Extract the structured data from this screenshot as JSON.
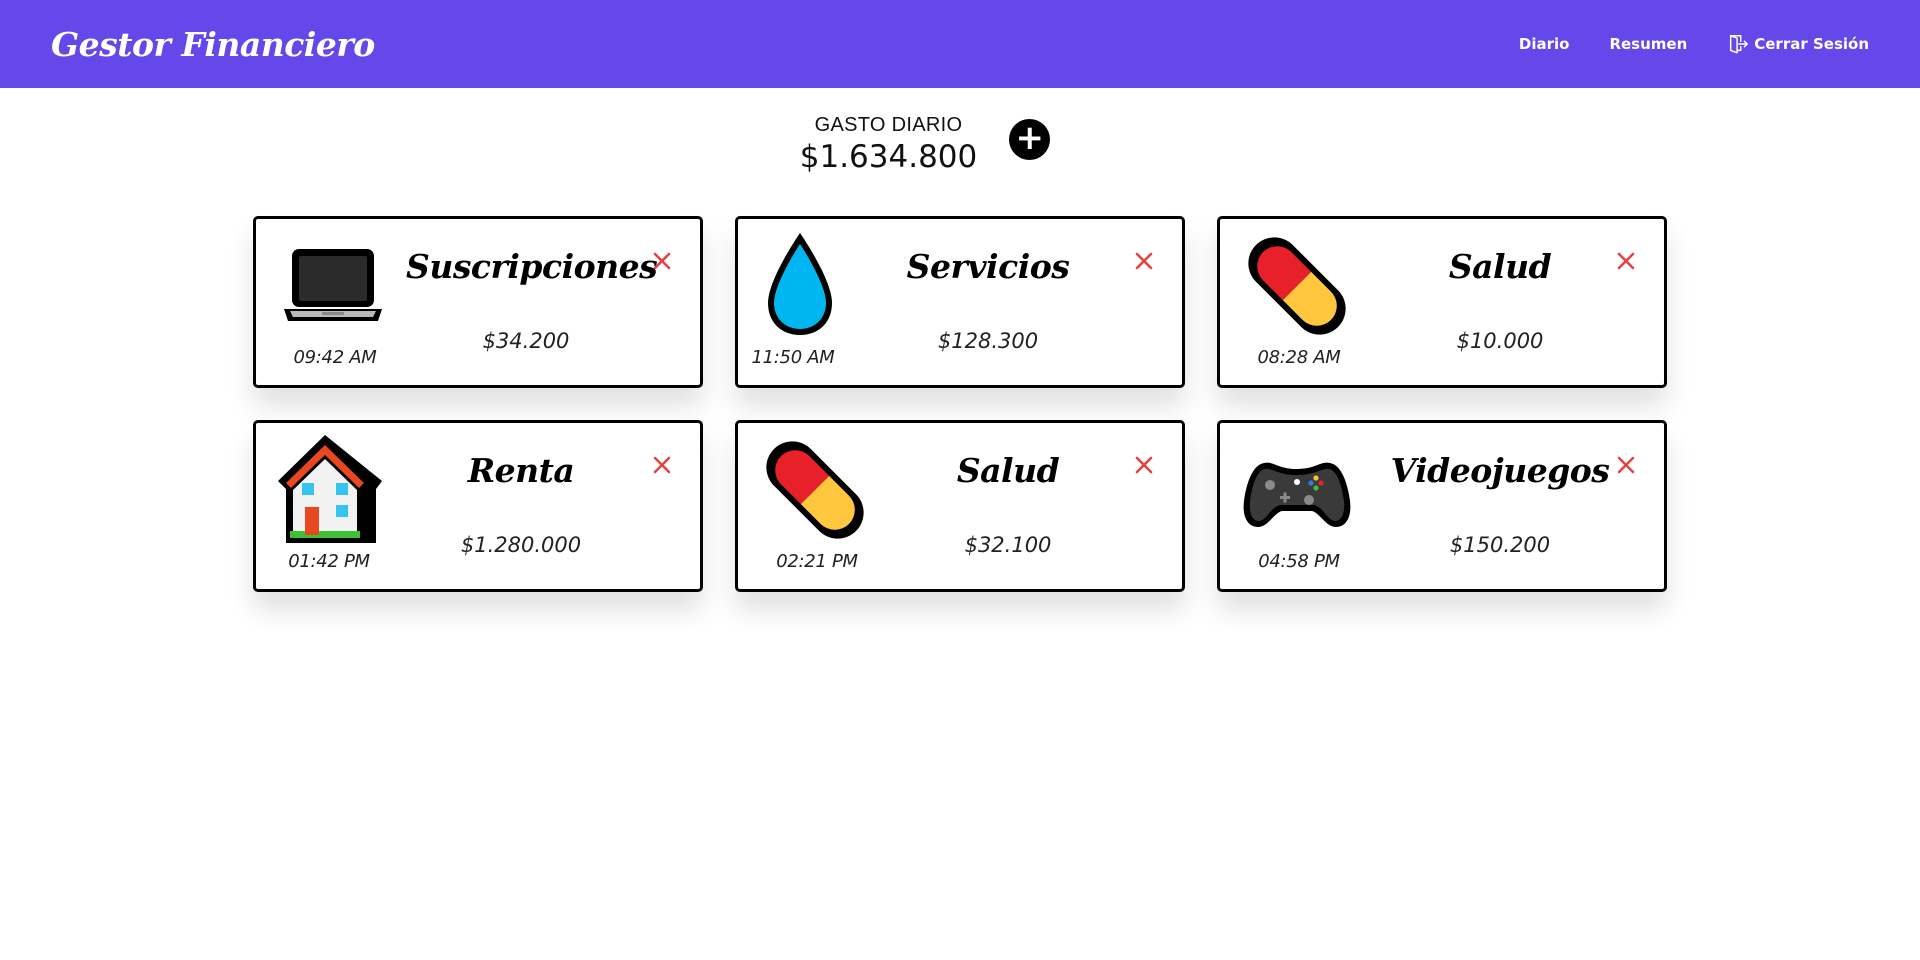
{
  "app": {
    "brand": "Gestor Financiero"
  },
  "nav": {
    "diario": "Diario",
    "resumen": "Resumen",
    "logout": "Cerrar Sesión"
  },
  "summary": {
    "label": "GASTO DIARIO",
    "total": "$1.634.800",
    "add_icon": "plus-circle-icon"
  },
  "colors": {
    "header": "#6448ea",
    "delete": "#e04545",
    "pill_red": "#e8202a",
    "pill_yellow": "#ffc73d",
    "water": "#00b6f0"
  },
  "expenses": [
    {
      "category": "Suscripciones",
      "amount": "$34.200",
      "time": "09:42 AM",
      "icon": "laptop-icon"
    },
    {
      "category": "Servicios",
      "amount": "$128.300",
      "time": "11:50 AM",
      "icon": "water-drop-icon"
    },
    {
      "category": "Salud",
      "amount": "$10.000",
      "time": "08:28 AM",
      "icon": "pill-icon"
    },
    {
      "category": "Renta",
      "amount": "$1.280.000",
      "time": "01:42 PM",
      "icon": "house-icon"
    },
    {
      "category": "Salud",
      "amount": "$32.100",
      "time": "02:21 PM",
      "icon": "pill-icon"
    },
    {
      "category": "Videojuegos",
      "amount": "$150.200",
      "time": "04:58 PM",
      "icon": "gamepad-icon"
    }
  ]
}
